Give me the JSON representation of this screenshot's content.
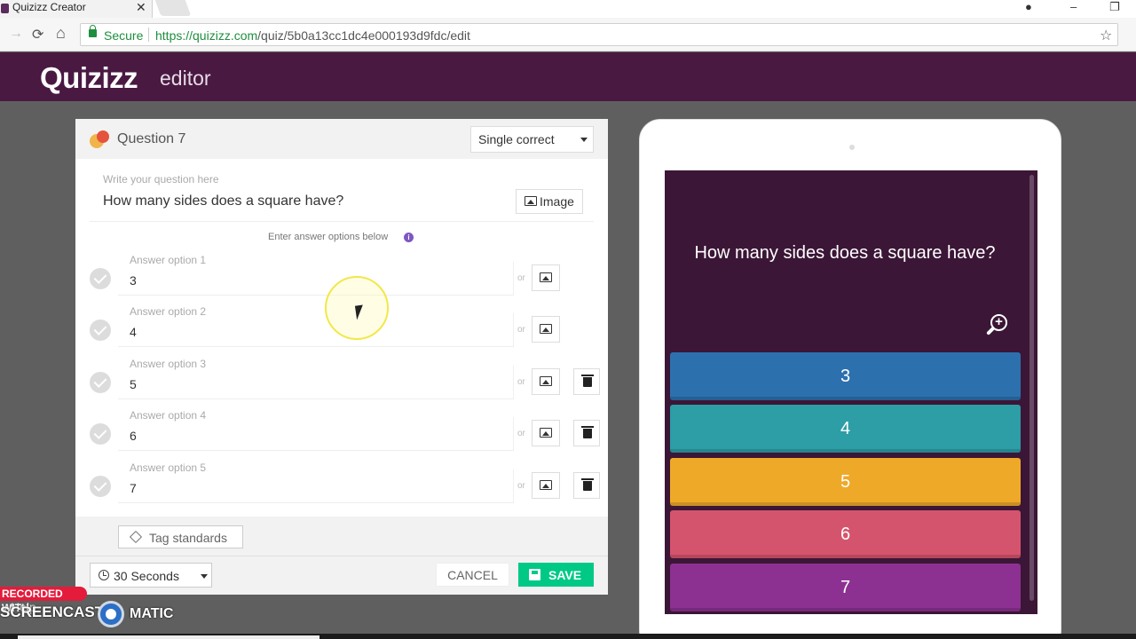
{
  "browser": {
    "tab_title": "Quizizz Creator",
    "tab_close": "✕",
    "secure_label": "Secure",
    "url_host": "https://quizizz.com",
    "url_path": "/quiz/5b0a13cc1dc4e000193d9fdc/edit",
    "back": "→",
    "reload": "⟳",
    "home": "⌂",
    "star": "☆",
    "minimize": "–",
    "restore": "❐",
    "account": "●"
  },
  "app": {
    "logo": "Quizizz",
    "section": "editor"
  },
  "editor": {
    "question_label": "Question 7",
    "question_type": "Single correct",
    "question_placeholder": "Write your question here",
    "question_text": "How many sides does a square have?",
    "image_button": "Image",
    "hint": "Enter answer options below",
    "info": "i",
    "or": "or",
    "options": [
      {
        "label": "Answer option 1",
        "value": "3",
        "deletable": false
      },
      {
        "label": "Answer option 2",
        "value": "4",
        "deletable": false
      },
      {
        "label": "Answer option 3",
        "value": "5",
        "deletable": true
      },
      {
        "label": "Answer option 4",
        "value": "6",
        "deletable": true
      },
      {
        "label": "Answer option 5",
        "value": "7",
        "deletable": true
      }
    ],
    "tag_button": "Tag standards",
    "time_value": "30 Seconds",
    "cancel": "CANCEL",
    "save": "SAVE"
  },
  "preview": {
    "question_text": "How many sides does a square have?",
    "zoom": "+",
    "answers": [
      {
        "text": "3",
        "color": "#2d70ae"
      },
      {
        "text": "4",
        "color": "#2d9da6"
      },
      {
        "text": "5",
        "color": "#efa929"
      },
      {
        "text": "6",
        "color": "#d5546d"
      },
      {
        "text": "7",
        "color": "#8c3191"
      }
    ]
  },
  "watermark": {
    "line1": "RECORDED WITH",
    "line2": "SCREENCAST",
    "line3": "MATIC",
    "help": "Help"
  },
  "colors": {
    "header": "#4a1942",
    "save": "#00c985",
    "preview_bg": "#3b1636"
  }
}
